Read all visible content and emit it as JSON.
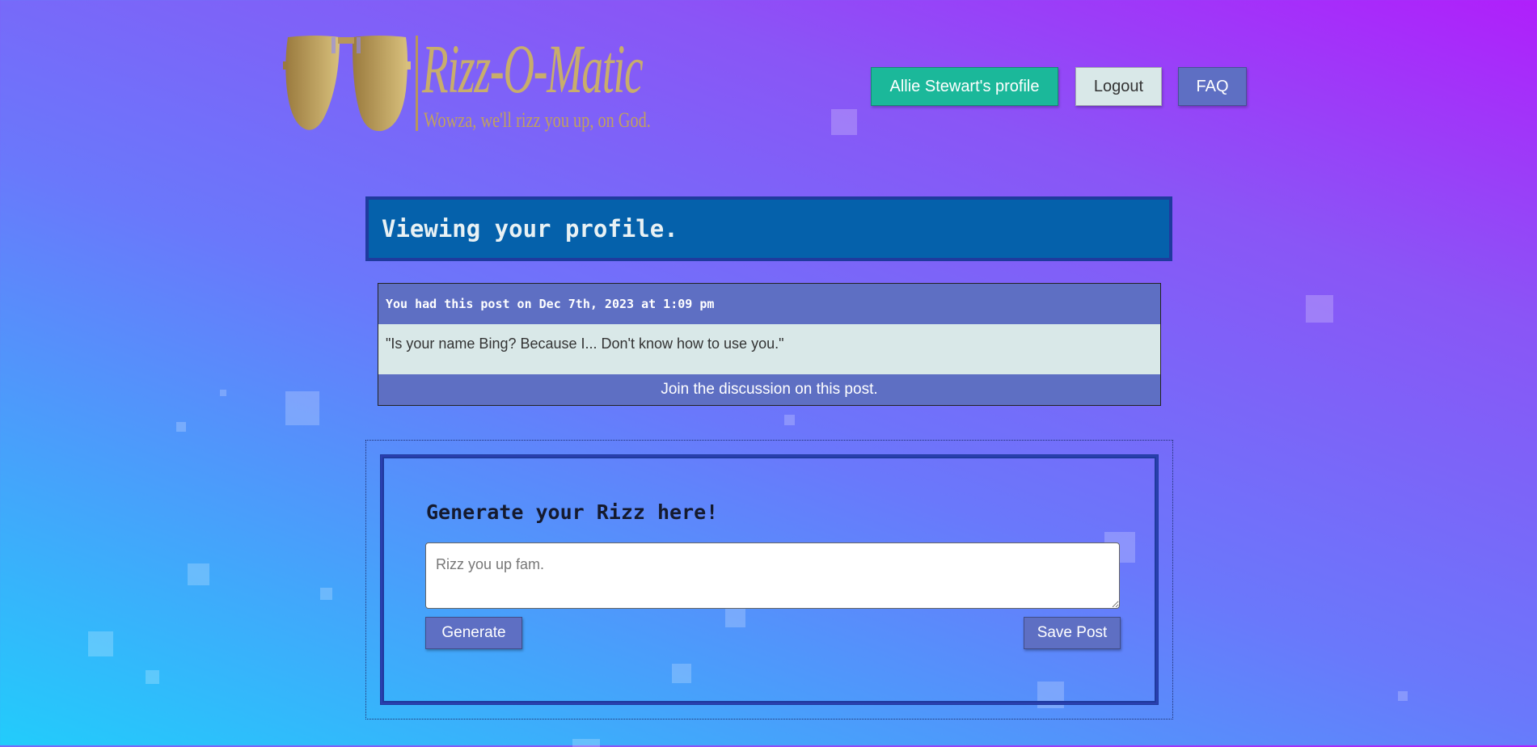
{
  "logo": {
    "title": "Rizz-O-Matic",
    "tagline": "Wowza, we'll rizz you up, on God.",
    "icon": "aviator-sunglasses-icon",
    "colors": {
      "gold_dark": "#9a7a3e",
      "gold_light": "#d8c07c"
    }
  },
  "nav": {
    "profile_label": "Allie Stewart's profile",
    "logout_label": "Logout",
    "faq_label": "FAQ"
  },
  "banner": {
    "title": "Viewing your profile."
  },
  "post": {
    "header": "You had this post on Dec 7th, 2023 at 1:09 pm",
    "text": "\"Is your name Bing? Because I... Don't know how to use you.\"",
    "discussion_link": "Join the discussion on this post."
  },
  "generator": {
    "title": "Generate your Rizz here!",
    "input_placeholder": "Rizz you up fam.",
    "input_value": "",
    "generate_label": "Generate",
    "save_label": "Save Post"
  },
  "colors": {
    "accent_teal": "#1bb89a",
    "accent_indigo": "#5e6fc3",
    "banner_blue": "#0561ab",
    "light_panel": "#d9e8e8"
  }
}
